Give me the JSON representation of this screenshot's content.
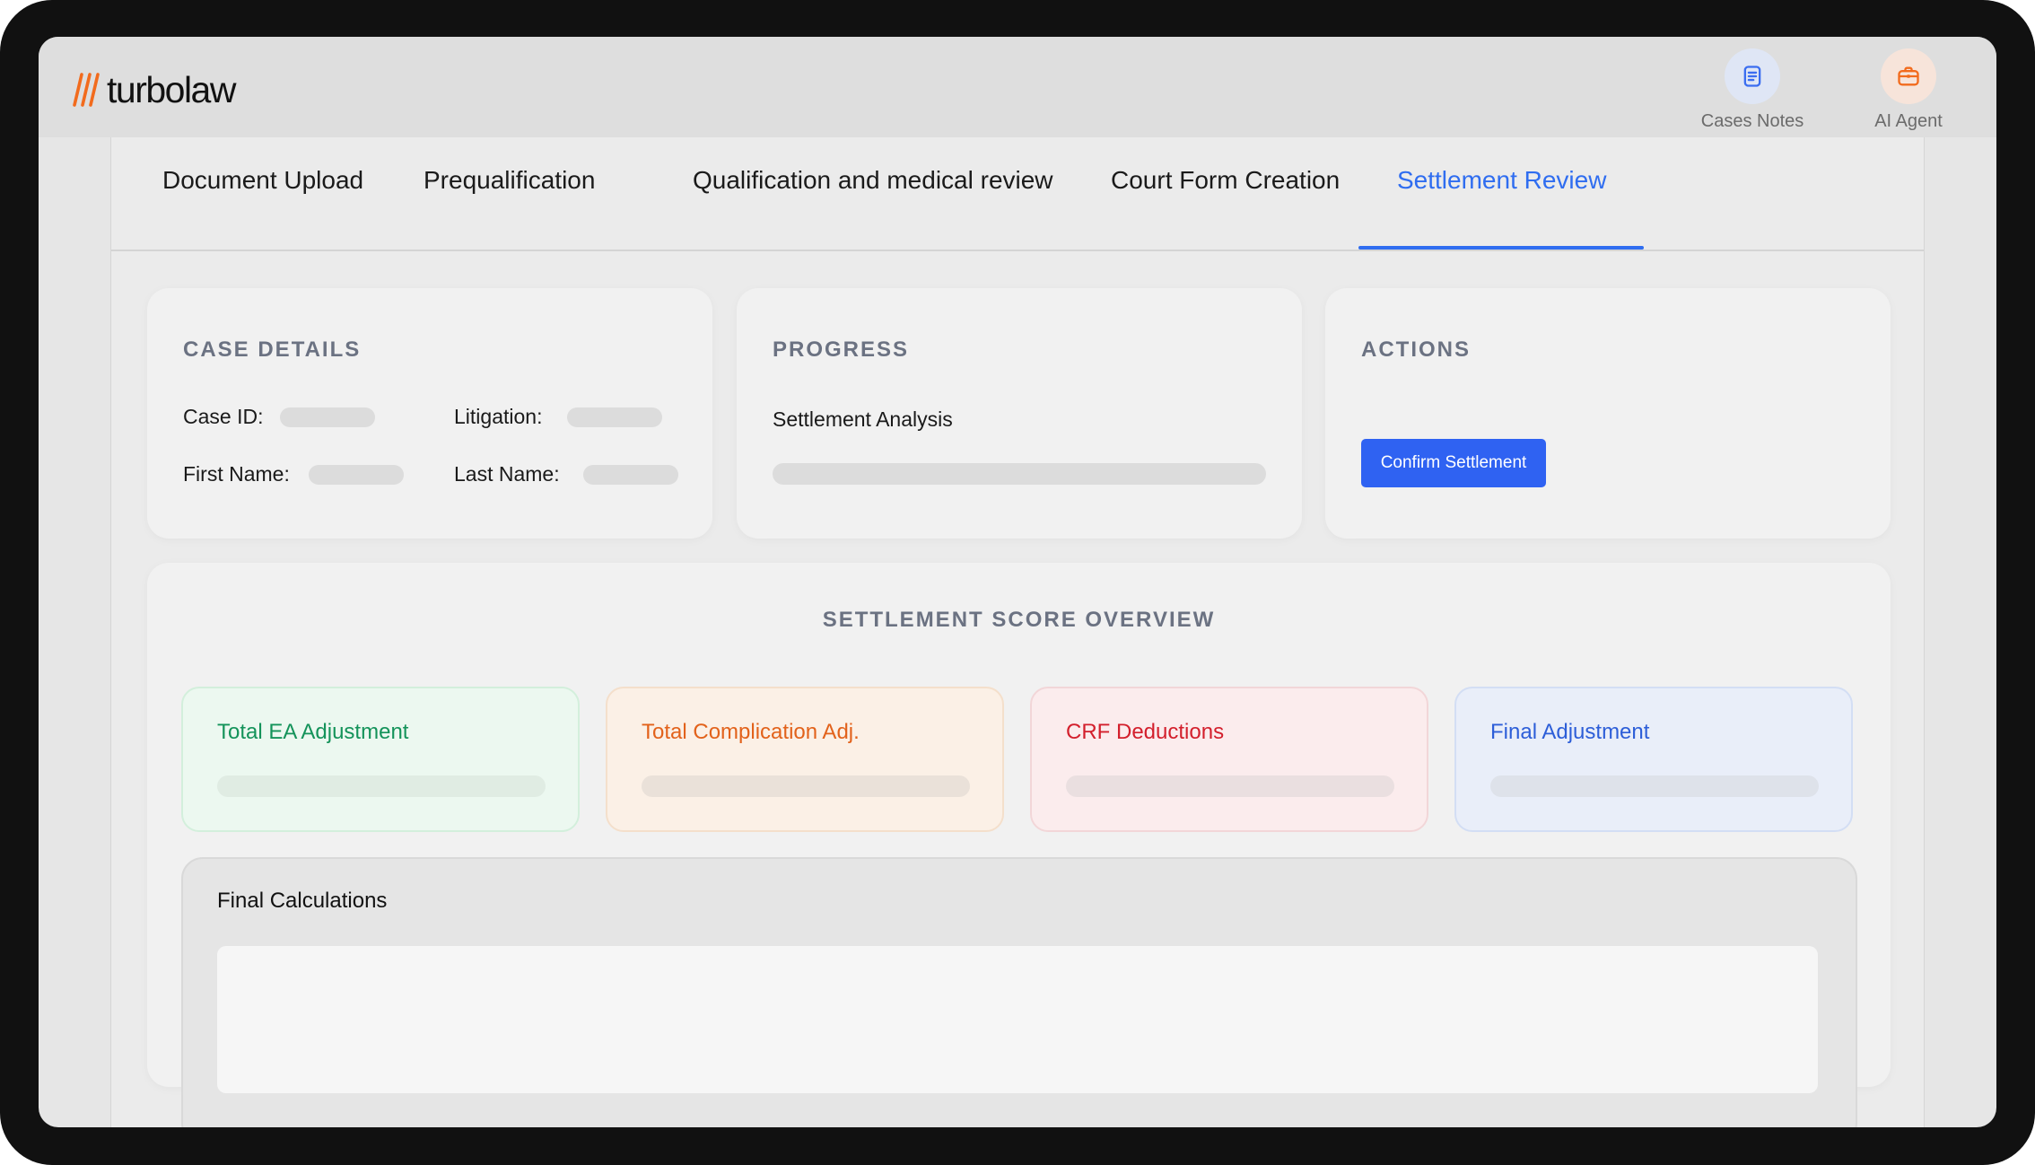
{
  "app": {
    "brand": "turbolaw",
    "brand_color": "#f26b1d",
    "accent_color": "#2f6df0"
  },
  "top_actions": {
    "cases_notes": {
      "label": "Cases Notes",
      "icon": "document-icon",
      "color": "#3b6ef0"
    },
    "ai_agent": {
      "label": "AI Agent",
      "icon": "briefcase-icon",
      "color": "#f26b1d"
    }
  },
  "tabs": [
    {
      "label": "Document Upload",
      "active": false
    },
    {
      "label": "Prequalification",
      "active": false
    },
    {
      "label": "Qualification and medical review",
      "active": false
    },
    {
      "label": "Court Form Creation",
      "active": false
    },
    {
      "label": "Settlement Review",
      "active": true
    }
  ],
  "case_details": {
    "title": "CASE DETAILS",
    "case_id_label": "Case ID:",
    "litigation_label": "Litigation:",
    "first_name_label": "First Name:",
    "last_name_label": "Last Name:"
  },
  "progress": {
    "title": "PROGRESS",
    "step_label": "Settlement Analysis"
  },
  "actions": {
    "title": "ACTIONS",
    "confirm_label": "Confirm Settlement"
  },
  "overview": {
    "title": "SETTLEMENT SCORE OVERVIEW",
    "cards": [
      {
        "label": "Total EA Adjustment",
        "text_color": "#14935a",
        "bg": "#ecf8f0",
        "border": "#d3efdc",
        "bar": "#e0ece3"
      },
      {
        "label": "Total Complication Adj.",
        "text_color": "#e2621b",
        "bg": "#fbf0e6",
        "border": "#f4dfcb",
        "bar": "#eae1d9"
      },
      {
        "label": "CRF Deductions",
        "text_color": "#d31f2c",
        "bg": "#fbeced",
        "border": "#f2d6d8",
        "bar": "#eadfe0"
      },
      {
        "label": "Final Adjustment",
        "text_color": "#2d5ed8",
        "bg": "#e9eef9",
        "border": "#d3def4",
        "bar": "#dee2ea"
      }
    ],
    "calculations_title": "Final Calculations"
  }
}
